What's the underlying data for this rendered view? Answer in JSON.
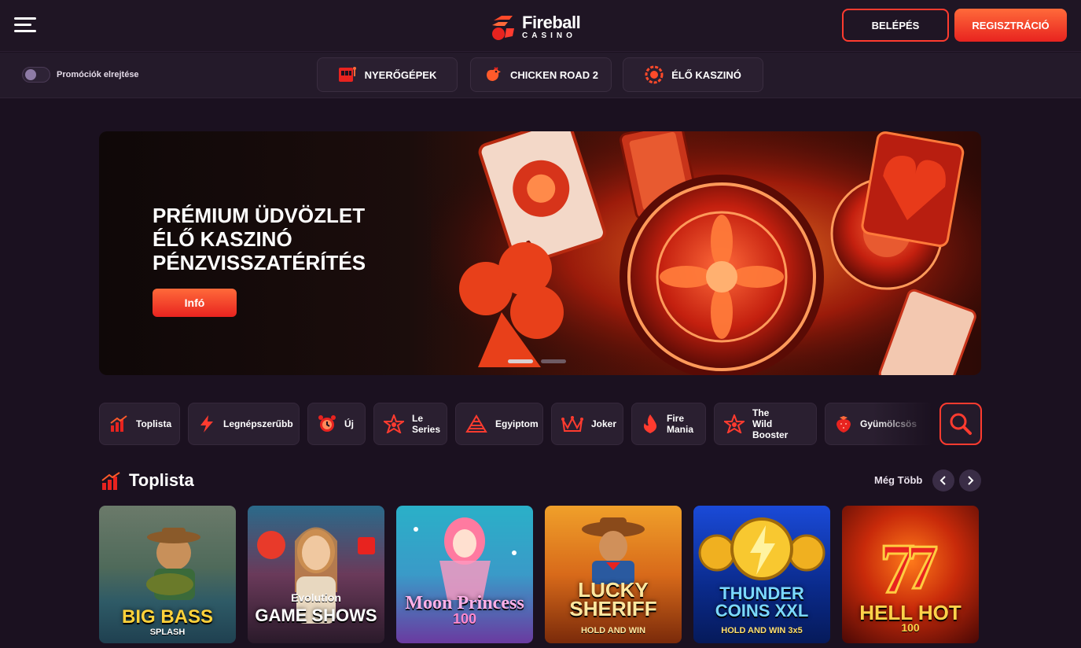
{
  "header": {
    "logo_line1": "Fireball",
    "logo_line2": "CASINO",
    "login_label": "BELÉPÉS",
    "register_label": "REGISZTRÁCIÓ"
  },
  "subnav": {
    "toggle_label": "Promóciók elrejtése",
    "tabs": [
      {
        "label": "NYERŐGÉPEK",
        "icon": "slot-machine-icon"
      },
      {
        "label": "CHICKEN ROAD 2",
        "icon": "chicken-icon"
      },
      {
        "label": "ÉLŐ KASZINÓ",
        "icon": "roulette-chip-icon"
      }
    ]
  },
  "banner": {
    "line1": "PRÉMIUM ÜDVÖZLET",
    "line2": "ÉLŐ KASZINÓ",
    "line3": "PÉNZVISSZATÉRÍTÉS",
    "button": "Infó",
    "slides": 2,
    "active_slide": 1
  },
  "categories": [
    {
      "label": "Toplista",
      "icon": "bar-chart-icon"
    },
    {
      "label": "Legnépszerűbb",
      "icon": "lightning-icon"
    },
    {
      "label": "Új",
      "icon": "alarm-clock-icon"
    },
    {
      "label1": "Le",
      "label2": "Series",
      "icon": "star-icon"
    },
    {
      "label": "Egyiptom",
      "icon": "pyramid-icon"
    },
    {
      "label": "Joker",
      "icon": "jester-hat-icon"
    },
    {
      "label1": "Fire",
      "label2": "Mania",
      "icon": "flame-icon"
    },
    {
      "label1": "The",
      "label2": "Wild Booster",
      "icon": "star-icon"
    },
    {
      "label": "Gyümölcsös",
      "icon": "strawberry-icon"
    }
  ],
  "section": {
    "title": "Toplista",
    "more_label": "Még Több"
  },
  "games": [
    {
      "title": "BIG BASS",
      "sub": "SPLASH"
    },
    {
      "title": "GAME SHOWS",
      "sub": "Evolution"
    },
    {
      "title": "Moon Princess",
      "sub": "100"
    },
    {
      "title": "LUCKY SHERIFF",
      "sub": "HOLD AND WIN"
    },
    {
      "title": "THUNDER COINS XXL",
      "sub": "HOLD AND WIN 3x5"
    },
    {
      "title": "HELL HOT",
      "sub": "100"
    }
  ],
  "colors": {
    "accent": "#ff3b2f",
    "background": "#1b1120",
    "panel": "#2a1f30"
  }
}
